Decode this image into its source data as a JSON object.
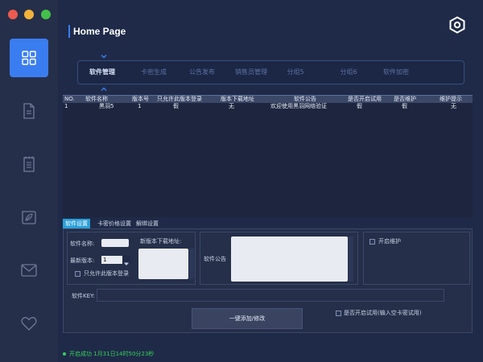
{
  "window": {
    "title": "Home Page"
  },
  "sidebar": {
    "items": [
      "dashboard-icon",
      "document-icon",
      "notepad-icon",
      "leaf-icon",
      "mail-icon",
      "heart-icon"
    ]
  },
  "tabs": [
    {
      "label": "软件管理",
      "active": true
    },
    {
      "label": "卡密生成",
      "active": false
    },
    {
      "label": "公告发布",
      "active": false
    },
    {
      "label": "销售员管理",
      "active": false
    },
    {
      "label": "分组5",
      "active": false
    },
    {
      "label": "分组6",
      "active": false
    },
    {
      "label": "软件加密",
      "active": false
    }
  ],
  "table": {
    "headers": [
      "NO.",
      "软件名称",
      "版本号",
      "只允许此版本登录",
      "版本下载地址",
      "软件公告",
      "是否开启试用",
      "是否维护",
      "维护提示"
    ],
    "rows": [
      [
        "1",
        "黑羽5",
        "1",
        "假",
        "无",
        "欢迎使用黑羽网络验证",
        "假",
        "假",
        "无"
      ]
    ]
  },
  "subtabs": [
    "软件设置",
    "卡密价格设置",
    "解绑设置"
  ],
  "form": {
    "name_label": "软件名称:",
    "name_value": "",
    "version_label": "最新版本:",
    "version_value": "1",
    "only_version_label": "只允许此版本登录",
    "download_label": "新版本下载地址:",
    "notice_label": "软件公告",
    "maintenance_label": "开启维护",
    "key_label": "软件KEY:",
    "key_value": "",
    "submit_label": "一键添加/修改",
    "trial_label": "是否开启试用(输入空卡密试用)"
  },
  "status": {
    "text": "开启成功  1月31日14时50分23秒"
  },
  "colors": {
    "accent": "#3a7df0",
    "status_green": "#35d25a",
    "subtab_active": "#2b9fd8"
  }
}
